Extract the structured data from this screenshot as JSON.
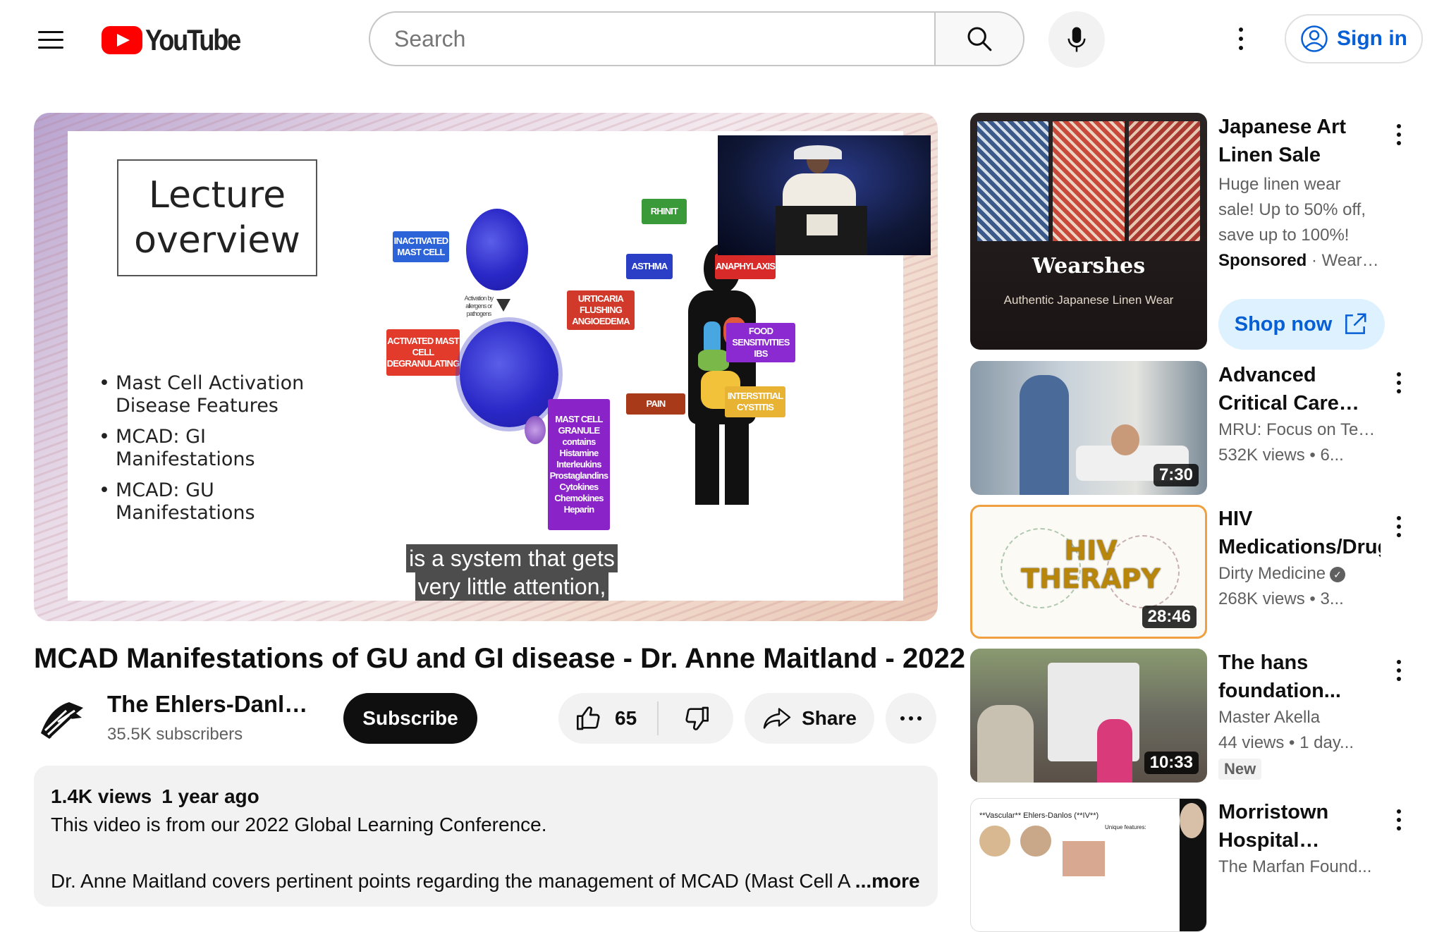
{
  "header": {
    "logo_text": "YouTube",
    "search_placeholder": "Search",
    "sign_in_label": "Sign in"
  },
  "player": {
    "slide": {
      "title": "Lecture overview",
      "bullets": [
        "Mast Cell Activation Disease Features",
        "MCAD: GI Manifestations",
        "MCAD: GU Manifestations"
      ],
      "diagram_labels": {
        "inactivated": "INACTIVATED MAST CELL",
        "activation_note": "Activation by allergens or pathogens",
        "activated": "ACTIVATED MAST CELL DEGRANULATING",
        "granule": "MAST CELL GRANULE contains Histamine Interleukins Prostaglandins Cytokines Chemokines Heparin",
        "urticaria": "URTICARIA FLUSHING ANGIOEDEMA",
        "rhinitis": "RHINIT",
        "asthma": "ASTHMA",
        "anaphylaxis": "ANAPHYLAXIS",
        "food": "FOOD SENSITIVITIES IBS",
        "interstitial": "INTERSTITIAL CYSTITIS",
        "pain": "PAIN"
      }
    },
    "captions": [
      "is a system that gets",
      "very little attention,"
    ]
  },
  "video": {
    "title": "MCAD Manifestations of GU and GI disease - Dr. Anne Maitland - 2022",
    "channel_name": "The Ehlers-Danlos...",
    "subscribers": "35.5K subscribers",
    "subscribe_label": "Subscribe",
    "like_count": "65",
    "share_label": "Share"
  },
  "description": {
    "views": "1.4K views",
    "age": "1 year ago",
    "line1": "This video is from our 2022 Global Learning Conference.",
    "line2": "Dr. Anne Maitland covers pertinent points regarding the management of MCAD (Mast Cell A",
    "more_label": "...more"
  },
  "recommendations": [
    {
      "type": "ad",
      "title": "Japanese Art Linen Sale",
      "body": "Huge linen wear sale! Up to 50% off, save up to 100%!",
      "sponsored_label": "Sponsored",
      "advertiser": "Wears...",
      "thumb_brand": "Wearshes",
      "thumb_tagline": "Authentic Japanese Linen Wear",
      "cta_label": "Shop now"
    },
    {
      "title": "Advanced Critical Care Nursing:...",
      "channel": "MRU: Focus on Tea...",
      "stats": "532K views  • 6...",
      "duration": "7:30"
    },
    {
      "title": "HIV Medications/Drug",
      "channel": "Dirty Medicine",
      "verified": true,
      "stats": "268K views  • 3...",
      "duration": "28:46",
      "thumb_text": [
        "HIV",
        "THERAPY"
      ]
    },
    {
      "title": "The hans foundation...",
      "channel": "Master Akella",
      "stats": "44 views  • 1 day...",
      "badge": "New",
      "duration": "10:33"
    },
    {
      "title": "Morristown Hospital Pediatr...",
      "channel": "The Marfan Found...",
      "thumb_text": [
        "**Vascular** Ehlers-Danlos (**IV**)",
        "Unique features:"
      ]
    }
  ],
  "colors": {
    "brand_red": "#ff0000",
    "link_blue": "#065fd4",
    "text_primary": "#0f0f0f",
    "text_secondary": "#606060"
  },
  "icons": {
    "menu": "hamburger-menu-icon",
    "search": "search-icon",
    "mic": "microphone-icon",
    "more": "more-vert-icon",
    "account": "account-circle-icon",
    "like": "thumb-up-icon",
    "dislike": "thumb-down-icon",
    "share": "share-arrow-icon",
    "open": "open-in-new-icon"
  }
}
